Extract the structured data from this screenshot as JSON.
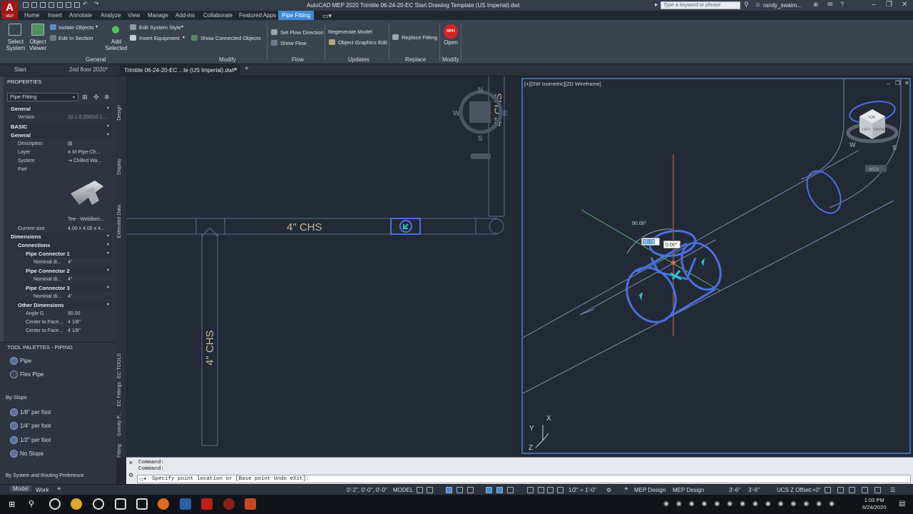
{
  "app": {
    "logo": "A",
    "logo_sub": "MEP",
    "title": "AutoCAD MEP 2020   Trimble 06-24-20-EC Start Drawing Template (US Imperial).dwt",
    "search_placeholder": "Type a keyword or phrase",
    "user": "randy_swaim..."
  },
  "menu": [
    "Home",
    "Insert",
    "Annotate",
    "Analyze",
    "View",
    "Manage",
    "Add-ins",
    "Collaborate",
    "Featured Apps",
    "Pipe Fitting"
  ],
  "ribbon": {
    "select_system": "Select System",
    "object_viewer": "Object Viewer",
    "isolate_objects": "Isolate Objects",
    "edit_in_section": "Edit In Section",
    "add_selected": "Add Selected",
    "edit_system_style": "Edit System Style",
    "insert_equipment": "Insert Equipment",
    "show_connected": "Show Connected Objects",
    "set_flow_direction": "Set Flow Direction",
    "show_flow": "Show Flow",
    "regenerate_model": "Regenerate Model",
    "object_graphics_edit": "Object Graphics Edit",
    "replace_fitting": "Replace Fitting",
    "open": "Open",
    "open_badge": "RPH",
    "panels": {
      "general": "General",
      "modify": "Modify",
      "flow": "Flow",
      "updates": "Updates",
      "replace": "Replace",
      "modify2": "Modify"
    }
  },
  "tabs": [
    "Start",
    "2nd floor 2020*",
    "Trimble 06-24-20-EC ...te (US Imperial).dwt*"
  ],
  "properties": {
    "title": "PROPERTIES",
    "selector": "Pipe Fitting",
    "general_hdr": "General",
    "version_label": "Version",
    "version_value": "10.1.0.200/10.1...",
    "basic_hdr": "BASIC",
    "general2_hdr": "General",
    "description_label": "Description",
    "layer_label": "Layer",
    "layer_value": "M-Pipe-Ch...",
    "system_label": "System",
    "system_value": "Chilled Wa...",
    "part_label": "Part",
    "part_name": "Tee - Weldben...",
    "current_size_label": "Current size",
    "current_size_value": "4.00 x 4.00 x 4...",
    "dimensions_hdr": "Dimensions",
    "connections_hdr": "Connections",
    "pc1": "Pipe Connector 1",
    "pc2": "Pipe Connector 2",
    "pc3": "Pipe Connector 3",
    "nominal_label": "Nominal di...",
    "nominal_value": "4\"",
    "other_dims_hdr": "Other Dimensions",
    "angle_label": "Angle G",
    "angle_value": "90.00",
    "ctf1_label": "Center to Face...",
    "ctf1_value": "4 1/8\"",
    "ctf2_label": "Center to Face...",
    "ctf2_value": "4 1/8\""
  },
  "side_tabs": [
    "Design",
    "Display",
    "Extended Data",
    "EC TOOLS",
    "EC Fittings",
    "Gravity P...",
    "Fitting"
  ],
  "palette": {
    "title": "TOOL PALETTES - PIPING",
    "pipe": "Pipe",
    "flex_pipe": "Flex Pipe",
    "by_slope": "By Slope",
    "s1": "1/8\" per foot",
    "s2": "1/4\" per foot",
    "s3": "1/2\" per foot",
    "no_slope": "No Slope",
    "by_system": "By System and Routing Preference"
  },
  "drawing": {
    "chs_label": "4\"  CHS",
    "chs_vertical": "4\"  CHS",
    "chs_right": "4\"  CHS",
    "compass_n": "N",
    "compass_s": "S",
    "compass_e": "E",
    "compass_w": "W",
    "viewport_label": "[+][SW Isometric][2D Wireframe]",
    "angle_text": "90.00°",
    "dyn_input_1": "90.00",
    "dyn_input_2": "0.00°",
    "viewcube_top": "TOP",
    "viewcube_left": "LEFT",
    "viewcube_front": "FRONT",
    "wcs": "WCS",
    "axis_x": "X",
    "axis_y": "Y",
    "axis_z": "Z"
  },
  "command": {
    "line1": "Command:",
    "line2": "Command:",
    "prompt": "Specify point location or [Base point Undo eXit]:"
  },
  "layout_tabs": [
    "Model",
    "Work"
  ],
  "status": {
    "coords": "0'-2\", 0'-0\", 0'-0\"",
    "model": "MODEL",
    "scale": "1/2\" = 1'-0\"",
    "mep1": "MEP Design",
    "mep2": "MEP Design",
    "dim1": "3'-6\"",
    "dim2": "3'-6\"",
    "ucs": "UCS Z Offset:+0\""
  },
  "clock": {
    "time": "1:03 PM",
    "date": "6/24/2020"
  },
  "colors": {
    "accent": "#3d8bd8",
    "pipe_blue": "#4b70e0",
    "cyan": "#2ec4c4",
    "autocad_red": "#a01818"
  }
}
